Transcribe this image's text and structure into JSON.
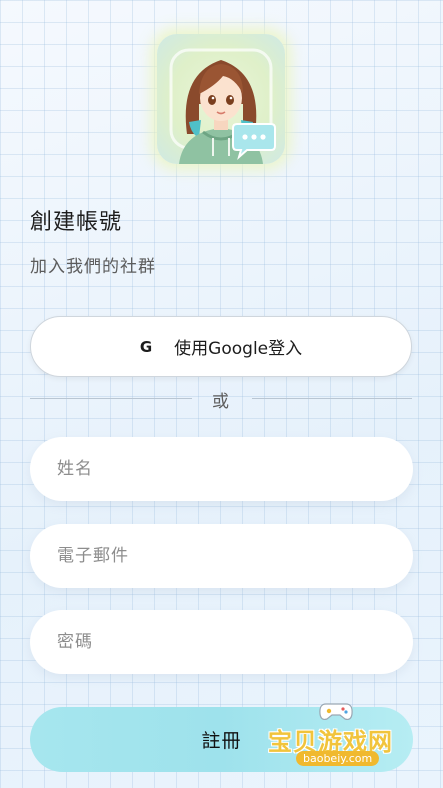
{
  "header": {
    "title": "創建帳號",
    "subtitle": "加入我們的社群"
  },
  "google_button": {
    "icon_letter": "G",
    "label": "使用Google登入"
  },
  "divider": {
    "label": "或"
  },
  "form": {
    "name_placeholder": "姓名",
    "email_placeholder": "電子郵件",
    "password_placeholder": "密碼"
  },
  "register_button": {
    "label": "註冊"
  },
  "watermark": {
    "text": "宝贝游戏网",
    "url": "baobeiy.com"
  },
  "colors": {
    "accent": "#a6e6ee",
    "background": "#f3f8fd",
    "watermark": "#f1c43c"
  },
  "icons": [
    "avatar-logo-icon",
    "chat-bubble-icon",
    "google-icon",
    "gamepad-icon"
  ]
}
